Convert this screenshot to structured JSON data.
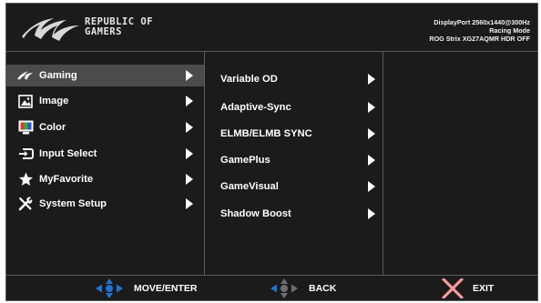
{
  "header": {
    "brand_line1": "REPUBLIC OF",
    "brand_line2": "GAMERS",
    "status": {
      "signal": "DisplayPort 2560x1440@300Hz",
      "mode": "Racing Mode",
      "model": "ROG Strix XG27AQMR HDR OFF"
    }
  },
  "main_menu": [
    {
      "label": "Gaming",
      "icon": "rog-gaming-icon",
      "selected": true
    },
    {
      "label": "Image",
      "icon": "image-icon"
    },
    {
      "label": "Color",
      "icon": "color-icon"
    },
    {
      "label": "Input Select",
      "icon": "input-select-icon"
    },
    {
      "label": "MyFavorite",
      "icon": "star-icon"
    },
    {
      "label": "System Setup",
      "icon": "wrench-screwdriver-icon"
    }
  ],
  "sub_menu": [
    {
      "label": "Variable OD"
    },
    {
      "label": "Adaptive-Sync"
    },
    {
      "label": "ELMB/ELMB SYNC"
    },
    {
      "label": "GamePlus"
    },
    {
      "label": "GameVisual"
    },
    {
      "label": "Shadow Boost"
    }
  ],
  "footer": {
    "move_enter": "MOVE/ENTER",
    "back": "BACK",
    "exit": "EXIT"
  },
  "colors": {
    "background": "#1b1b1b",
    "selected": "#4b4b4b",
    "nav_blue": "#1e73d2",
    "exit_pink": "#f29a9a"
  }
}
